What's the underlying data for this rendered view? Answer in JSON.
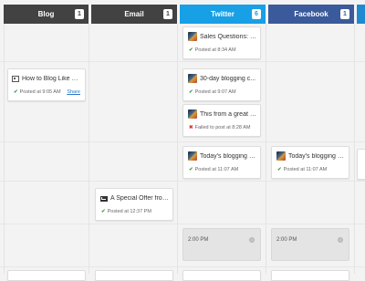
{
  "colors": {
    "blog_header": "#424242",
    "email_header": "#424242",
    "twitter_header": "#18a0e6",
    "facebook_header": "#3a5a9b",
    "success": "#3aa24b",
    "failed": "#d23a2c"
  },
  "columns": [
    {
      "name": "Blog",
      "count": "1"
    },
    {
      "name": "Email",
      "count": "1"
    },
    {
      "name": "Twitter",
      "count": "6"
    },
    {
      "name": "Facebook",
      "count": "1"
    }
  ],
  "cards": {
    "blog_1": {
      "title": "How to Blog Like a ...",
      "status": "Posted at 9:05 AM",
      "share": "Share",
      "icon": "document-icon"
    },
    "email_1": {
      "title": "A Special Offer from...",
      "status": "Posted at 12:37 PM",
      "icon": "envelope-icon"
    },
    "twitter_1": {
      "title": "Sales Questions: h...",
      "status": "Posted at 8:34 AM"
    },
    "twitter_2": {
      "title": "30-day blogging c...",
      "status": "Posted at 9:07 AM"
    },
    "twitter_3": {
      "title": "This from a great c...",
      "status": "Failed to post at 8:28 AM"
    },
    "twitter_4": {
      "title": "Today's blogging ti...",
      "status": "Posted at 11:07 AM"
    },
    "facebook_1": {
      "title": "Today's blogging ti...",
      "status": "Posted at 11:07 AM"
    }
  },
  "slots": {
    "twitter": {
      "time": "2:00 PM",
      "icon": "add-icon"
    },
    "facebook": {
      "time": "2:00 PM",
      "icon": "add-icon"
    }
  }
}
